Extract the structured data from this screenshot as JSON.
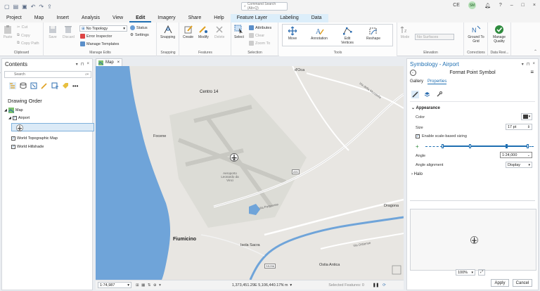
{
  "quick_access": [
    "new-icon",
    "open-icon",
    "save-icon",
    "undo-icon",
    "redo-icon",
    "share-icon"
  ],
  "command_search": {
    "placeholder": "Command Search (Alt+Q)"
  },
  "user": {
    "initials_left": "CE",
    "avatar": "SM"
  },
  "window": {
    "help": "?",
    "minimize": "–",
    "maximize": "□",
    "close": "×"
  },
  "tabs": [
    "Project",
    "Map",
    "Insert",
    "Analysis",
    "View",
    "Edit",
    "Imagery",
    "Share",
    "Help"
  ],
  "active_tab": "Edit",
  "context_tabs": {
    "group": "Feature Layer",
    "labeling": "Labeling",
    "data": "Data"
  },
  "ribbon": {
    "clipboard": {
      "label": "Clipboard",
      "paste": "Paste",
      "cut": "Cut",
      "copy": "Copy",
      "copy_path": "Copy Path"
    },
    "manage_edits": {
      "label": "Manage Edits",
      "save": "Save",
      "discard": "Discard",
      "topology": "No Topology",
      "error_inspector": "Error Inspector",
      "manage_templates": "Manage Templates",
      "status": "Status",
      "settings": "Settings"
    },
    "snapping": {
      "label": "Snapping",
      "snapping": "Snapping"
    },
    "features": {
      "label": "Features",
      "create": "Create",
      "modify": "Modify",
      "delete": "Delete"
    },
    "selection": {
      "label": "Selection",
      "select": "Select",
      "attributes": "Attributes",
      "clear": "Clear",
      "zoom_to": "Zoom To"
    },
    "tools": {
      "label": "Tools",
      "move": "Move",
      "annotation": "Annotation",
      "edit_vertices": "Edit Vertices",
      "reshape": "Reshape"
    },
    "elevation": {
      "label": "Elevation",
      "mode": "Mode",
      "surface": "No Surfaces"
    },
    "corrections": {
      "label": "Corrections",
      "ground_to_grid": "Ground To Grid"
    },
    "data_reviewer": {
      "label": "Data Revi...",
      "manage_quality": "Manage Quality"
    }
  },
  "contents": {
    "title": "Contents",
    "search_placeholder": "Search",
    "drawing_order": "Drawing Order",
    "layers": {
      "map": "Map",
      "airport": "Airport",
      "topo": "World Topographic Map",
      "hillshade": "World Hillshade"
    }
  },
  "map": {
    "tab": "Map",
    "labels": {
      "ostia": "d'Oca",
      "centro": "Centro 14",
      "focene": "Focene",
      "airport": "Aeroporto Leonardo da Vinci",
      "road1": "Via Portuense",
      "road2": "Via della Muratella",
      "dragona": "Dragona",
      "fiumicino": "Fiumicino",
      "isola": "Isola Sacra",
      "ostia_antica": "Ostia Antica",
      "road3": "Via Ostiense",
      "shield1": "A91",
      "shield2": "SS296"
    },
    "status": {
      "scale": "1:74,987",
      "coords": "1,373,451.29E 5,106,440.17N m",
      "selected": "Selected Features: 0"
    }
  },
  "symbology": {
    "title": "Symbology - Airport",
    "subtitle": "Format Point Symbol",
    "tabs": [
      "Gallery",
      "Properties"
    ],
    "active_tab": "Properties",
    "appearance": "Appearance",
    "color_label": "Color",
    "size_label": "Size",
    "size_value": "17 pt",
    "scale_based": "Enable scale-based sizing",
    "angle_label": "Angle",
    "angle_value": "1:24,000",
    "angle_alignment_label": "Angle alignment",
    "angle_alignment_value": "Display",
    "halo": "Halo",
    "zoom": "100%",
    "apply": "Apply",
    "cancel": "Cancel"
  },
  "colors": {
    "accent": "#1f6fb2",
    "water": "#6fa4d9",
    "land": "#e8e6e2",
    "ribbon_active": "#1f6fb2"
  }
}
